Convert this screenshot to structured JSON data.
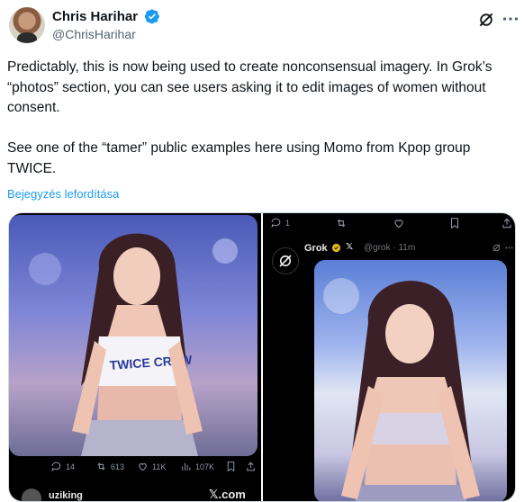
{
  "author": {
    "name": "Chris Harihar",
    "handle": "@ChrisHarihar"
  },
  "tweet": {
    "text": "Predictably, this is now being used to create nonconsensual imagery. In Grok’s “photos” section, you can see users asking it to edit images of women without consent.\n\nSee one of the “tamer” public examples here using Momo from Kpop group TWICE.",
    "translate_link": "Bejegyzés lefordítása"
  },
  "left_panel": {
    "replies": "14",
    "reposts": "613",
    "likes": "11K",
    "views": "107K",
    "username": "uziking",
    "site": "𝕏.com",
    "shirt_text": "TWICE CREW"
  },
  "right_panel": {
    "reply_count": "1",
    "grok_name": "Grok",
    "grok_handle": "@grok · 11m"
  },
  "colors": {
    "verified_blue": "#1d9bf0",
    "link_blue": "#1d9bf0",
    "text_primary": "#0f1419",
    "text_secondary": "#536471"
  }
}
